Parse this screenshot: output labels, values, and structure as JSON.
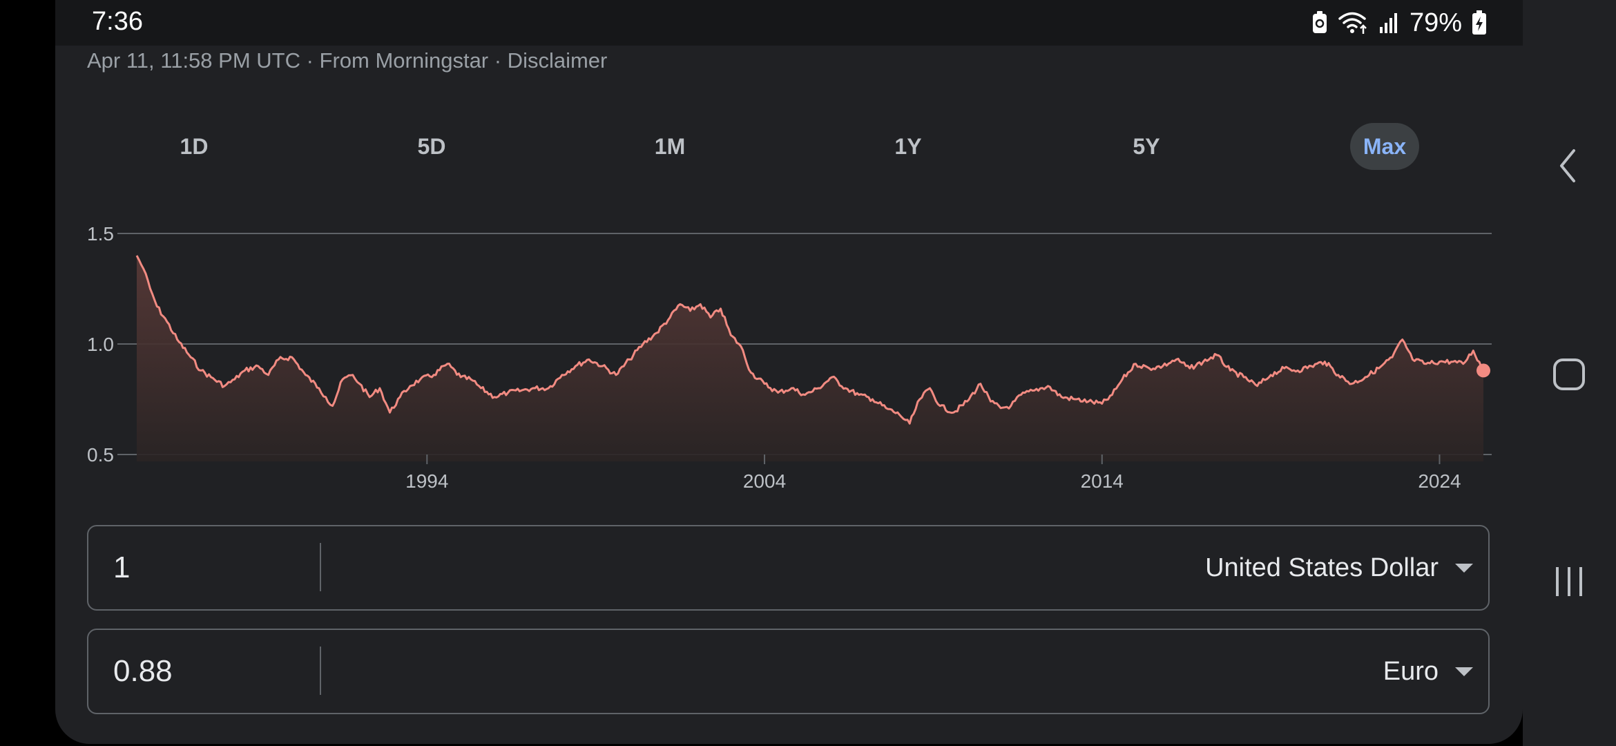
{
  "status_bar": {
    "time": "7:36",
    "battery_percent": "79%",
    "icons": [
      "data-saver-icon",
      "wifi-icon",
      "cellular-signal-icon",
      "battery-charging-icon"
    ]
  },
  "source_line": "Apr 11, 11:58 PM UTC · From Morningstar · Disclaimer",
  "range_tabs": {
    "items": [
      "1D",
      "5D",
      "1M",
      "1Y",
      "5Y",
      "Max"
    ],
    "selected": "Max"
  },
  "chart_data": {
    "type": "area",
    "y_ticks": [
      "1.5",
      "1.0",
      "0.5"
    ],
    "x_ticks": [
      "1994",
      "2004",
      "2014",
      "2024"
    ],
    "ylim": [
      0.5,
      1.5
    ],
    "xlim": [
      1985.4,
      2025.3
    ],
    "grid": true,
    "line_color": "#f28b82",
    "series": [
      {
        "x": [
          1985.4,
          1985.6,
          1985.8,
          1986.0,
          1986.3,
          1986.6,
          1987.0,
          1987.3,
          1987.6,
          1988.0,
          1988.3,
          1988.6,
          1989.0,
          1989.3,
          1989.6,
          1990.0,
          1990.4,
          1990.8,
          1991.0,
          1991.2,
          1991.5,
          1991.8,
          1992.0,
          1992.3,
          1992.6,
          1992.9,
          1993.2,
          1993.5,
          1993.8,
          1994.2,
          1994.6,
          1995.0,
          1995.3,
          1995.6,
          1996.0,
          1996.4,
          1996.8,
          1997.2,
          1997.6,
          1998.0,
          1998.4,
          1998.8,
          1999.2,
          1999.6,
          2000.0,
          2000.4,
          2000.8,
          2001.2,
          2001.5,
          2001.8,
          2002.1,
          2002.4,
          2002.7,
          2003.0,
          2003.3,
          2003.6,
          2004.0,
          2004.4,
          2004.8,
          2005.2,
          2005.6,
          2006.0,
          2006.4,
          2006.8,
          2007.2,
          2007.6,
          2008.0,
          2008.3,
          2008.6,
          2008.9,
          2009.2,
          2009.6,
          2010.0,
          2010.4,
          2010.7,
          2011.0,
          2011.3,
          2011.6,
          2012.0,
          2012.4,
          2012.8,
          2013.2,
          2013.6,
          2014.0,
          2014.3,
          2014.6,
          2015.0,
          2015.4,
          2015.8,
          2016.2,
          2016.6,
          2017.0,
          2017.4,
          2017.8,
          2018.2,
          2018.6,
          2019.0,
          2019.4,
          2019.8,
          2020.2,
          2020.6,
          2021.0,
          2021.4,
          2021.8,
          2022.2,
          2022.6,
          2022.9,
          2023.2,
          2023.6,
          2024.0,
          2024.4,
          2024.7,
          2025.0,
          2025.3
        ],
        "y": [
          1.4,
          1.34,
          1.25,
          1.17,
          1.1,
          1.02,
          0.94,
          0.88,
          0.85,
          0.81,
          0.84,
          0.88,
          0.9,
          0.86,
          0.93,
          0.94,
          0.86,
          0.8,
          0.76,
          0.72,
          0.84,
          0.86,
          0.82,
          0.76,
          0.8,
          0.69,
          0.76,
          0.81,
          0.84,
          0.86,
          0.91,
          0.85,
          0.84,
          0.8,
          0.76,
          0.78,
          0.79,
          0.8,
          0.8,
          0.86,
          0.9,
          0.93,
          0.9,
          0.86,
          0.93,
          1.0,
          1.05,
          1.12,
          1.18,
          1.15,
          1.18,
          1.12,
          1.16,
          1.04,
          0.99,
          0.87,
          0.82,
          0.78,
          0.8,
          0.77,
          0.8,
          0.85,
          0.8,
          0.77,
          0.75,
          0.71,
          0.68,
          0.64,
          0.75,
          0.8,
          0.72,
          0.69,
          0.74,
          0.82,
          0.74,
          0.71,
          0.72,
          0.77,
          0.79,
          0.81,
          0.76,
          0.75,
          0.74,
          0.73,
          0.77,
          0.84,
          0.91,
          0.89,
          0.9,
          0.93,
          0.89,
          0.92,
          0.95,
          0.88,
          0.85,
          0.81,
          0.86,
          0.89,
          0.88,
          0.9,
          0.92,
          0.86,
          0.82,
          0.85,
          0.89,
          0.94,
          1.02,
          0.93,
          0.91,
          0.92,
          0.92,
          0.91,
          0.97,
          0.88
        ]
      }
    ]
  },
  "converter": {
    "from": {
      "amount": "1",
      "currency": "United States Dollar"
    },
    "to": {
      "amount": "0.88",
      "currency": "Euro"
    }
  }
}
